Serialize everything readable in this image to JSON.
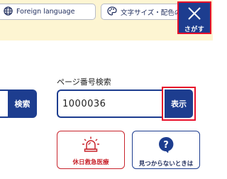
{
  "header": {
    "language_button": "Foreign language",
    "display_button": "文字サイズ・配色の変更",
    "close_button_label": "さがす"
  },
  "site_search": {
    "button_label": "検索"
  },
  "page_search": {
    "title": "ページ番号検索",
    "value": "1000036",
    "button_label": "表示"
  },
  "cards": {
    "emergency_label": "休日救急医療",
    "help_label": "見つからないときは"
  },
  "colors": {
    "navy": "#1d3d8f",
    "header_bg": "#fdf5d2",
    "highlight_red": "#e8102a",
    "emergency_red": "#c8242c"
  }
}
